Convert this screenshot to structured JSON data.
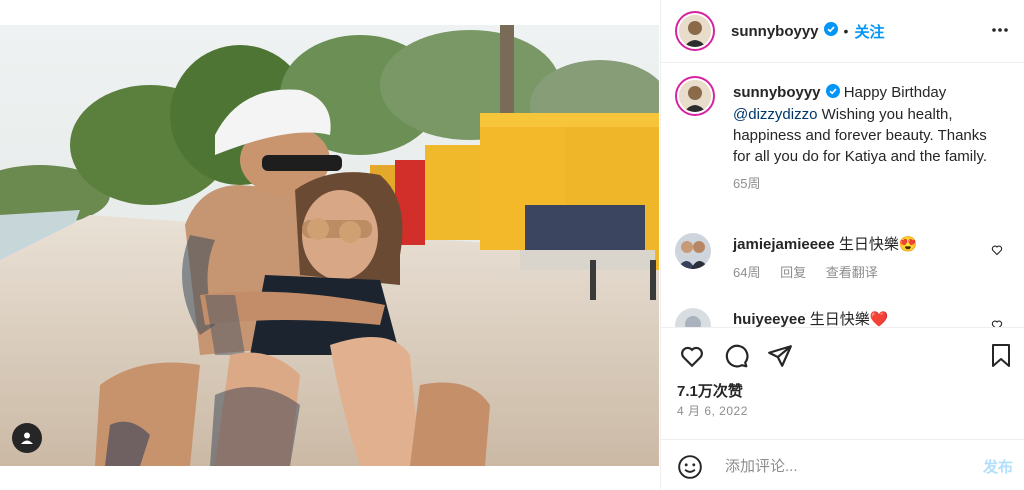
{
  "post": {
    "author": "sunnyboyyy",
    "separator": "•",
    "follow_label": "关注",
    "verified_icon": "verified-badge-icon",
    "more_icon": "more-options-icon"
  },
  "caption": {
    "author": "sunnyboyyy",
    "text_before": " Happy Birthday ",
    "mention": "@dizzydizzo",
    "text_after": " Wishing you health, happiness and forever beauty. Thanks for all you do for Katiya and the family.",
    "time": "65周"
  },
  "comments": [
    {
      "user": "jamiejamieeee",
      "text": "生日快樂😍",
      "time": "64周",
      "reply": "回复",
      "translate": "查看翻译"
    },
    {
      "user": "huiyeeyee",
      "text": "生日快樂❤️"
    }
  ],
  "actions": {
    "like_icon": "heart-icon",
    "comment_icon": "comment-icon",
    "share_icon": "share-icon",
    "save_icon": "bookmark-icon"
  },
  "likes": "7.1万次赞",
  "date": "4 月 6, 2022",
  "composer": {
    "placeholder": "添加评论...",
    "post_label": "发布",
    "emoji_icon": "emoji-icon"
  },
  "colors": {
    "accent": "#0095f6",
    "verified": "#0095f6",
    "muted": "#8e8e8e",
    "post_disabled": "#b2dffc",
    "canopy": "#f3b92b"
  }
}
